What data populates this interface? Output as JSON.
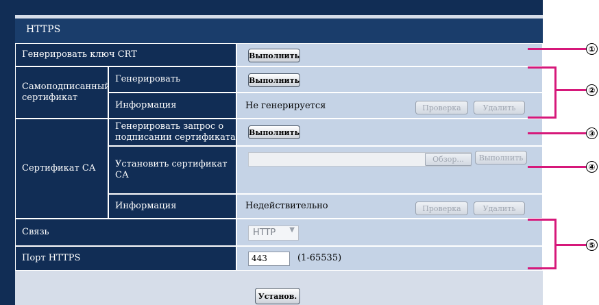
{
  "section_title": "HTTPS",
  "rows": {
    "generate_crt": {
      "label": "Генерировать ключ CRT",
      "button": "Выполнить"
    },
    "self_signed": {
      "label": "Самоподписанный сертификат",
      "generate": {
        "label": "Генерировать",
        "button": "Выполнить"
      },
      "info": {
        "label": "Информация",
        "status": "Не генерируется",
        "check_button": "Проверка",
        "delete_button": "Удалить"
      }
    },
    "ca_cert": {
      "label": "Сертификат СА",
      "request": {
        "label": "Генерировать запрос о подписании сертификата",
        "button": "Выполнить"
      },
      "install": {
        "label": "Установить сертификат СА",
        "browse_button": "Обзор...",
        "execute_button": "Выполнить",
        "file_value": ""
      },
      "info": {
        "label": "Информация",
        "status": "Недействительно",
        "check_button": "Проверка",
        "delete_button": "Удалить"
      }
    },
    "connection": {
      "label": "Связь",
      "selected": "HTTP"
    },
    "https_port": {
      "label": "Порт HTTPS",
      "value": "443",
      "range": "(1-65535)"
    }
  },
  "set_button": "Установ.",
  "callouts": [
    "①",
    "②",
    "③",
    "④",
    "⑤"
  ],
  "colors": {
    "header_bg": "#1a3d6b",
    "label_bg": "#112d55",
    "value_bg": "#c5d3e6",
    "callout_line": "#d6187a"
  }
}
